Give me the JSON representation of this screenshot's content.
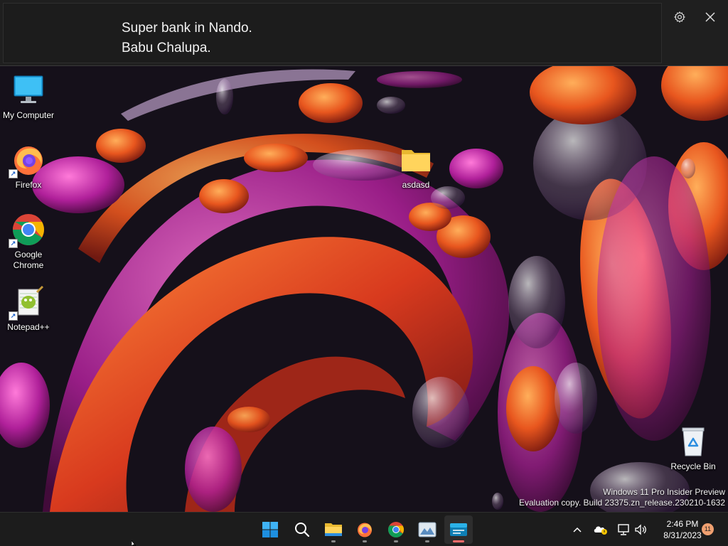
{
  "caption": {
    "lines": [
      "Super bank in Nando.",
      "Babu Chalupa."
    ],
    "settings_icon": "gear-icon",
    "close_icon": "close-icon"
  },
  "desktop": {
    "icons": [
      {
        "label": "My Computer",
        "icon": "monitor-icon"
      },
      {
        "label": "Firefox",
        "icon": "firefox-icon"
      },
      {
        "label": "Google Chrome",
        "icon": "chrome-icon"
      },
      {
        "label": "Notepad++",
        "icon": "notepadpp-icon"
      },
      {
        "label": "asdasd",
        "icon": "folder-icon"
      },
      {
        "label": "Recycle Bin",
        "icon": "recycle-bin-icon"
      }
    ]
  },
  "watermark": {
    "line1": "Windows 11 Pro Insider Preview",
    "line2": "Evaluation copy. Build 23375.zn_release.230210-1632"
  },
  "taskbar": {
    "apps": [
      "start-icon",
      "search-icon",
      "file-explorer-icon",
      "firefox-icon",
      "chrome-icon",
      "photos-icon",
      "live-captions-icon"
    ],
    "clock": {
      "time": "2:46 PM",
      "date": "8/31/2023"
    },
    "notification_count": "11"
  },
  "colors": {
    "caption_bg": "#1f1f1f",
    "taskbar_bg": "#1c1c1c",
    "accent_indicator": "#ff6b6b"
  }
}
